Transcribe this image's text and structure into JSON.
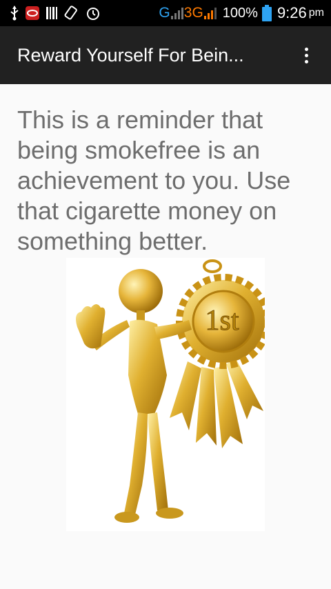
{
  "status_bar": {
    "icons": [
      "usb-icon",
      "app-notification-icon",
      "barcode-icon",
      "rotate-icon",
      "alarm-icon",
      "signal-icon"
    ],
    "network_g": "G",
    "network_3g": "3G",
    "battery_percent": "100%",
    "time": "9:26",
    "ampm": "pm"
  },
  "app_bar": {
    "title": "Reward Yourself For Bein...",
    "overflow_icon": "overflow-menu-icon"
  },
  "main": {
    "message": "This is a reminder that being smokefree is an achievement to you. Use that cigarette money on something better.",
    "image": {
      "description_icon": "gold-figure-award-ribbon-icon",
      "ribbon_text": "1st"
    }
  },
  "colors": {
    "status_bar_bg": "#000000",
    "app_bar_bg": "#212121",
    "content_bg": "#fafafa",
    "message_text": "#6d6d6d",
    "gold": "#e0b030",
    "network_g": "#2ea3f2",
    "network_3g": "#ff7a00",
    "battery": "#2ea3f2"
  }
}
